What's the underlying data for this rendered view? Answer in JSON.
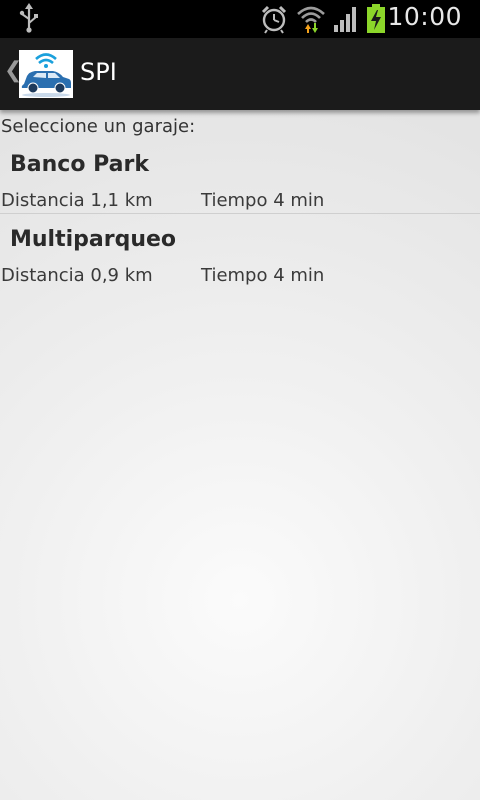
{
  "status_bar": {
    "time": "10:00",
    "icons": [
      "usb-icon",
      "alarm-icon",
      "wifi-icon",
      "signal-icon",
      "battery-charging-icon"
    ]
  },
  "action_bar": {
    "title": "SPI",
    "icons": [
      "up-caret-icon",
      "app-logo-car-wifi-icon"
    ]
  },
  "main": {
    "prompt": "Seleccione un garaje:",
    "garages": [
      {
        "name": "Banco Park",
        "distance": "Distancia 1,1 km",
        "time": "Tiempo 4 min"
      },
      {
        "name": "Multiparqueo",
        "distance": "Distancia 0,9 km",
        "time": "Tiempo 4 min"
      }
    ]
  },
  "colors": {
    "status_bar_bg": "#000000",
    "action_bar_bg": "#1b1b1b",
    "wifi_blue": "#1aa0dc",
    "battery_green": "#8cd62a",
    "car_blue": "#2a6fb0"
  }
}
